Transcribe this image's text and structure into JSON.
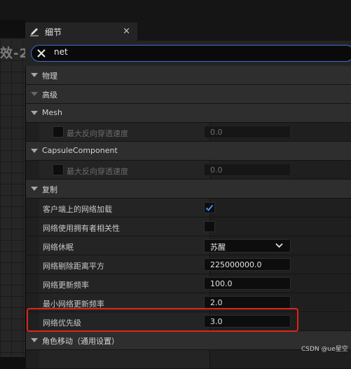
{
  "background": {
    "viewport_text": "效-2"
  },
  "tab": {
    "title": "细节",
    "close": "×"
  },
  "search": {
    "value": "net"
  },
  "sections": {
    "physics": "物理",
    "advanced": "高级",
    "mesh": "Mesh",
    "capsule": "CapsuleComponent",
    "replication": "复制",
    "movement": "角色移动（通用设置）"
  },
  "properties": {
    "mesh_max_penetration": {
      "label": "最大反向穿透速度",
      "value": "0.0"
    },
    "capsule_max_penetration": {
      "label": "最大反向穿透速度",
      "value": "0.0"
    },
    "net_load_on_client": {
      "label": "客户端上的网络加载",
      "checked": true
    },
    "net_use_owner_relevancy": {
      "label": "网络使用拥有者相关性",
      "checked": false
    },
    "net_dormancy": {
      "label": "网络休眠",
      "value": "苏醒"
    },
    "net_cull_distance": {
      "label": "网络剔除距离平方",
      "value": "225000000.0"
    },
    "net_update_frequency": {
      "label": "网络更新频率",
      "value": "100.0"
    },
    "min_net_update_frequency": {
      "label": "最小网络更新频率",
      "value": "2.0"
    },
    "net_priority": {
      "label": "网络优先级",
      "value": "3.0"
    }
  },
  "watermark": "CSDN @ue星空",
  "colors": {
    "accent": "#3d6fd0",
    "highlight": "#e0231c",
    "check": "#4a8cff"
  }
}
